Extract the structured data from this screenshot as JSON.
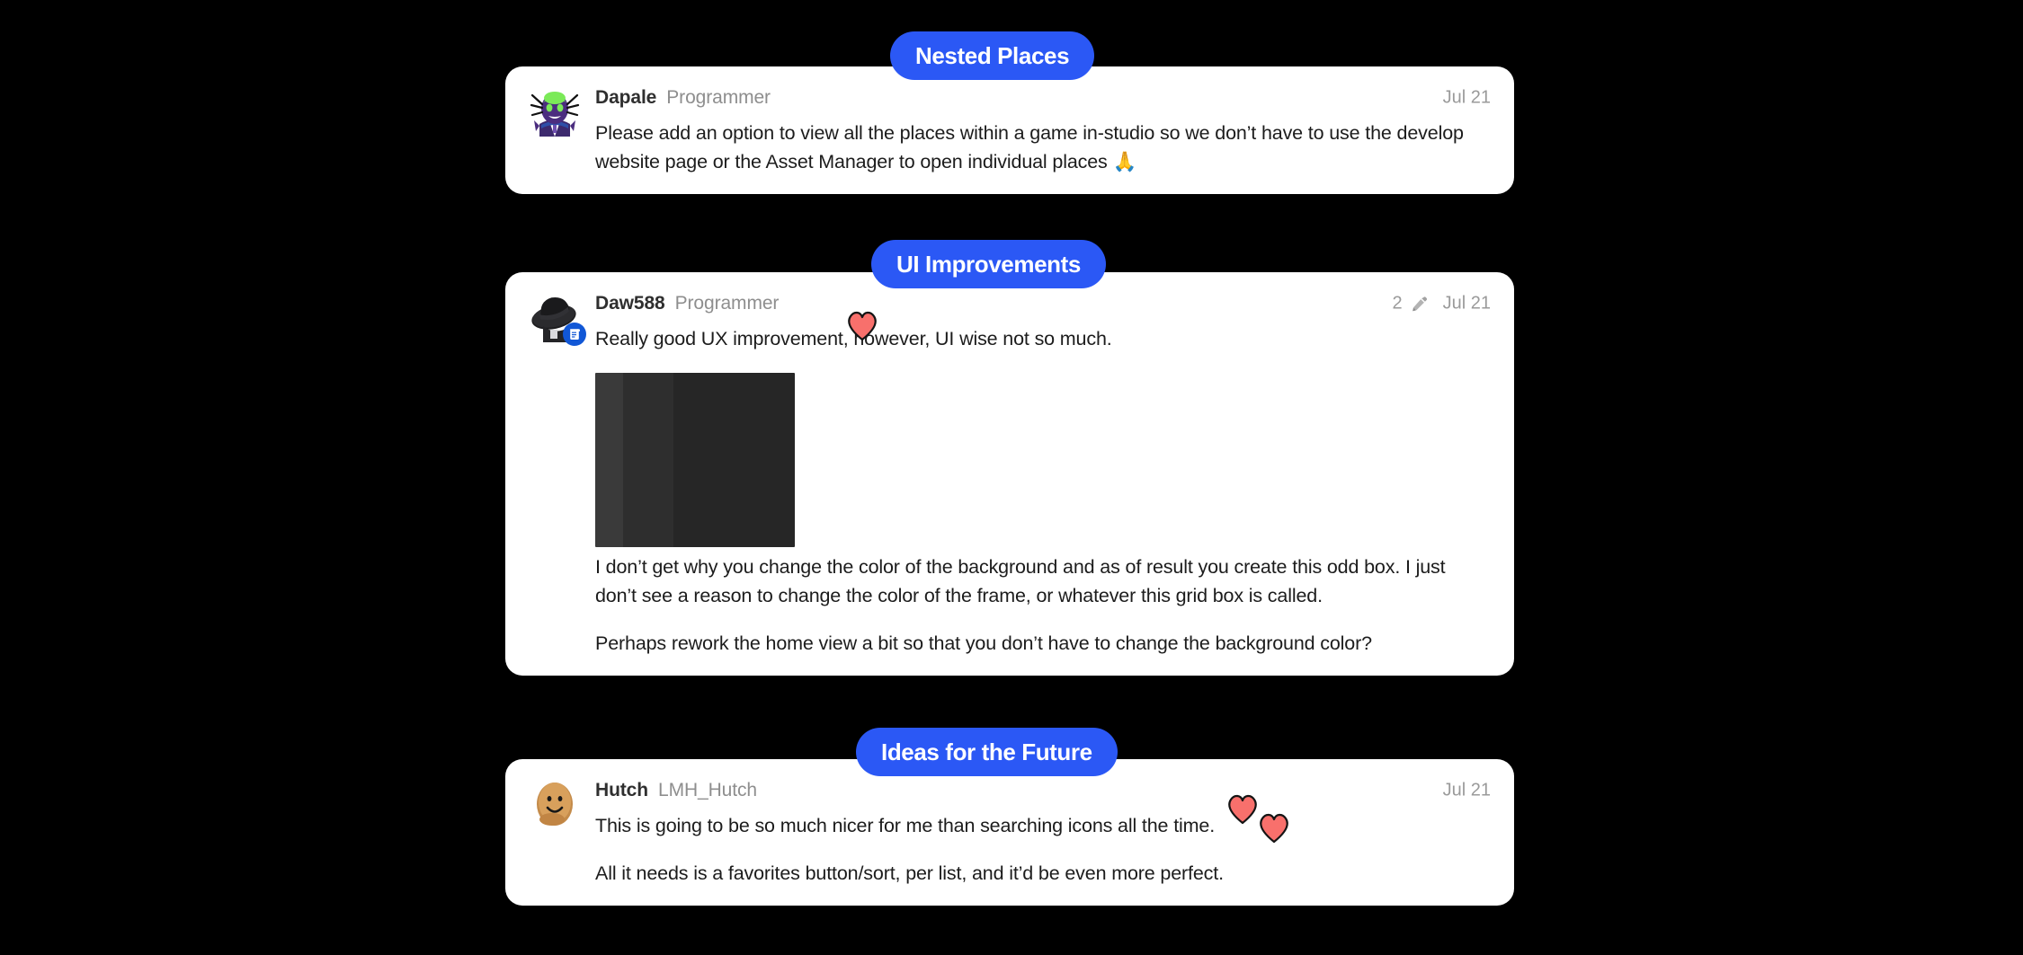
{
  "page": {
    "background_color": "#000000",
    "card_background": "#ffffff",
    "accent_color": "#2b58f5",
    "heart_color": "#f8706c",
    "muted_text_color": "#9a9a9a"
  },
  "posts": [
    {
      "id": "nested-places",
      "category_tag": "Nested Places",
      "username": "Dapale",
      "user_role": "Programmer",
      "date": "Jul 21",
      "edit_count": "",
      "avatar_name": "dapale-avatar",
      "paragraphs": [
        "Please add an option to view all the places within a game in-studio so we don’t have to use the develop website page or the Asset Manager to open individual places 🙏"
      ]
    },
    {
      "id": "ui-improvements",
      "category_tag": "UI Improvements",
      "username": "Daw588",
      "user_role": "Programmer",
      "date": "Jul 21",
      "edit_count": "2",
      "avatar_name": "daw588-avatar",
      "badge_icon": "script-badge-icon",
      "paragraphs": [
        "Really good UX improvement, however, UI wise not so much.",
        "I don’t get why you change the color of the background and as of result you create this odd box. I just don’t see a reason to change the color of the frame, or whatever this grid box is called.",
        "Perhaps rework the home view a bit so that you don’t have to change the background color?"
      ],
      "embedded_image": {
        "name": "dark-ui-screenshot",
        "band_colors": [
          "#3a3a3a",
          "#2e2e2e",
          "#262626"
        ]
      }
    },
    {
      "id": "ideas-for-the-future",
      "category_tag": "Ideas for the Future",
      "username": "Hutch",
      "user_role": "LMH_Hutch",
      "date": "Jul 21",
      "edit_count": "",
      "avatar_name": "hutch-avatar",
      "paragraphs": [
        "This is going to be so much nicer for me than searching icons all the time.",
        "All it needs is a favorites button/sort, per list, and it’d be even more perfect."
      ]
    }
  ],
  "annotations": {
    "hearts": [
      {
        "name": "heart-annotation-1"
      },
      {
        "name": "heart-annotation-2"
      },
      {
        "name": "heart-annotation-3"
      }
    ]
  }
}
